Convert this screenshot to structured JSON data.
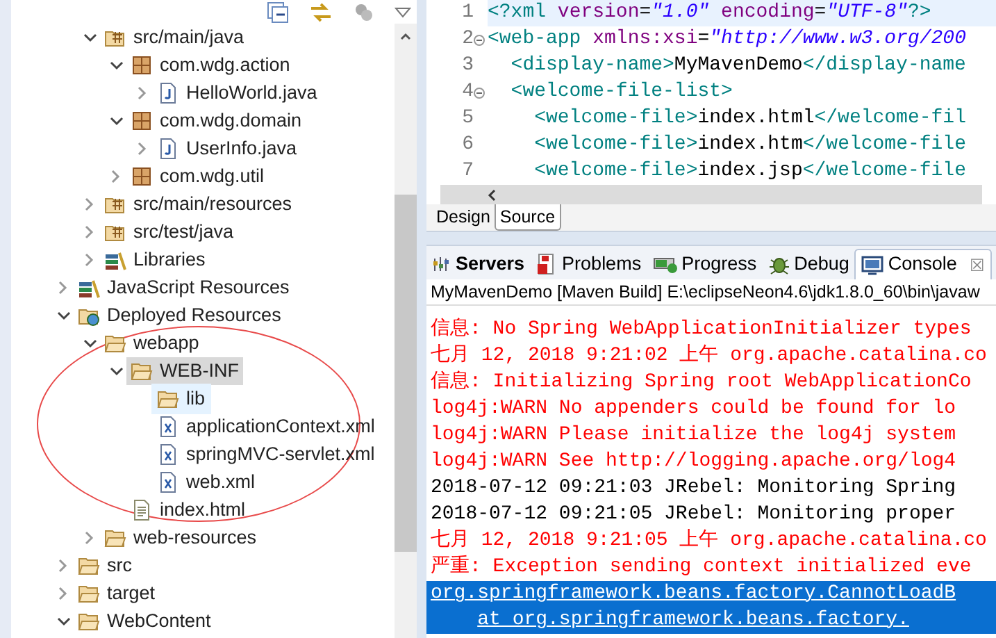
{
  "explorer": {
    "continued_items": [
      {
        "label": "src/main/java",
        "kind": "source-folder",
        "expanded": true,
        "selected": false,
        "hovered": false,
        "children": [
          {
            "label": "com.wdg.action",
            "kind": "package",
            "expanded": true,
            "selected": false,
            "hovered": false,
            "children": [
              {
                "label": "HelloWorld.java",
                "kind": "java-file",
                "expanded": false,
                "selected": false,
                "hovered": false
              }
            ]
          },
          {
            "label": "com.wdg.domain",
            "kind": "package",
            "expanded": true,
            "selected": false,
            "hovered": false,
            "children": [
              {
                "label": "UserInfo.java",
                "kind": "java-file",
                "expanded": false,
                "selected": false,
                "hovered": false
              }
            ]
          },
          {
            "label": "com.wdg.util",
            "kind": "package",
            "expanded": false,
            "selected": false,
            "hovered": false
          }
        ]
      },
      {
        "label": "src/main/resources",
        "kind": "source-folder",
        "expanded": false,
        "selected": false,
        "hovered": false
      },
      {
        "label": "src/test/java",
        "kind": "source-folder",
        "expanded": false,
        "selected": false,
        "hovered": false
      },
      {
        "label": "Libraries",
        "kind": "library",
        "expanded": false,
        "selected": false,
        "hovered": false
      }
    ],
    "items": [
      {
        "label": "JavaScript Resources",
        "kind": "library",
        "expanded": false,
        "selected": false,
        "hovered": false
      },
      {
        "label": "Deployed Resources",
        "kind": "deployed",
        "expanded": true,
        "selected": false,
        "hovered": false,
        "children": [
          {
            "label": "webapp",
            "kind": "folder",
            "expanded": true,
            "selected": false,
            "hovered": false,
            "children": [
              {
                "label": "WEB-INF",
                "kind": "folder",
                "expanded": true,
                "selected": true,
                "hovered": false,
                "children": [
                  {
                    "label": "lib",
                    "kind": "folder",
                    "selected": false,
                    "hovered": true
                  },
                  {
                    "label": "applicationContext.xml",
                    "kind": "xml-file",
                    "selected": false,
                    "hovered": false
                  },
                  {
                    "label": "springMVC-servlet.xml",
                    "kind": "xml-file",
                    "selected": false,
                    "hovered": false
                  },
                  {
                    "label": "web.xml",
                    "kind": "xml-file",
                    "selected": false,
                    "hovered": false
                  }
                ]
              },
              {
                "label": "index.html",
                "kind": "html-file",
                "selected": false,
                "hovered": false
              }
            ]
          },
          {
            "label": "web-resources",
            "kind": "folder",
            "expanded": false,
            "selected": false,
            "hovered": false
          }
        ]
      },
      {
        "label": "src",
        "kind": "folder",
        "expanded": false,
        "selected": false,
        "hovered": false
      },
      {
        "label": "target",
        "kind": "folder",
        "expanded": false,
        "selected": false,
        "hovered": false
      },
      {
        "label": "WebContent",
        "kind": "folder",
        "expanded": true,
        "selected": false,
        "hovered": false
      }
    ]
  },
  "editor": {
    "lines": [
      {
        "number": "1",
        "fold": false,
        "current": true,
        "tokens": [
          {
            "kind": "tag",
            "text": "<?xml"
          },
          {
            "kind": "attr",
            "text": " version"
          },
          {
            "kind": "plain",
            "text": "="
          },
          {
            "kind": "value",
            "text": "\"1.0\""
          },
          {
            "kind": "attr",
            "text": " encoding"
          },
          {
            "kind": "plain",
            "text": "="
          },
          {
            "kind": "value",
            "text": "\"UTF-8\""
          },
          {
            "kind": "tag",
            "text": "?>"
          }
        ]
      },
      {
        "number": "2",
        "fold": true,
        "current": false,
        "tokens": [
          {
            "kind": "tag",
            "text": "<web-app"
          },
          {
            "kind": "attr",
            "text": " xmlns:xsi"
          },
          {
            "kind": "plain",
            "text": "="
          },
          {
            "kind": "value",
            "text": "\"http://www.w3.org/200"
          }
        ]
      },
      {
        "number": "3",
        "fold": false,
        "current": false,
        "tokens": [
          {
            "kind": "tag",
            "text": "  <display-name>"
          },
          {
            "kind": "plain",
            "text": "MyMavenDemo"
          },
          {
            "kind": "tag",
            "text": "</display-name"
          }
        ]
      },
      {
        "number": "4",
        "fold": true,
        "current": false,
        "tokens": [
          {
            "kind": "tag",
            "text": "  <welcome-file-list>"
          }
        ]
      },
      {
        "number": "5",
        "fold": false,
        "current": false,
        "tokens": [
          {
            "kind": "tag",
            "text": "    <welcome-file>"
          },
          {
            "kind": "plain",
            "text": "index.html"
          },
          {
            "kind": "tag",
            "text": "</welcome-fil"
          }
        ]
      },
      {
        "number": "6",
        "fold": false,
        "current": false,
        "tokens": [
          {
            "kind": "tag",
            "text": "    <welcome-file>"
          },
          {
            "kind": "plain",
            "text": "index.htm"
          },
          {
            "kind": "tag",
            "text": "</welcome-file"
          }
        ]
      },
      {
        "number": "7",
        "fold": false,
        "current": false,
        "tokens": [
          {
            "kind": "tag",
            "text": "    <welcome-file>"
          },
          {
            "kind": "plain",
            "text": "index.jsp"
          },
          {
            "kind": "tag",
            "text": "</welcome-file"
          }
        ]
      }
    ],
    "tabs": [
      {
        "label": "Design",
        "selected": false
      },
      {
        "label": "Source",
        "selected": true
      }
    ]
  },
  "console": {
    "tabs": [
      {
        "label": "Servers",
        "kind": "servers",
        "bold": true,
        "selected": false
      },
      {
        "label": "Problems",
        "kind": "problems",
        "bold": false,
        "selected": false
      },
      {
        "label": "Progress",
        "kind": "progress",
        "bold": false,
        "selected": false
      },
      {
        "label": "Debug",
        "kind": "debug",
        "bold": false,
        "selected": false
      },
      {
        "label": "Console",
        "kind": "console",
        "bold": false,
        "selected": true,
        "close": "☒"
      }
    ],
    "title": "MyMavenDemo [Maven Build] E:\\eclipseNeon4.6\\jdk1.8.0_60\\bin\\javaw",
    "lines": [
      {
        "text": "信息: No Spring WebApplicationInitializer types",
        "color": "#ff0000",
        "selected": false
      },
      {
        "text": "七月 12, 2018 9:21:02 上午 org.apache.catalina.co",
        "color": "#ff0000",
        "selected": false
      },
      {
        "text": "信息: Initializing Spring root WebApplicationCo",
        "color": "#ff0000",
        "selected": false
      },
      {
        "text": "log4j:WARN No appenders could be found for lo",
        "color": "#ff0000",
        "selected": false
      },
      {
        "text": "log4j:WARN Please initialize the log4j system",
        "color": "#ff0000",
        "selected": false
      },
      {
        "text": "log4j:WARN See http://logging.apache.org/log4",
        "color": "#ff0000",
        "selected": false
      },
      {
        "text": "2018-07-12 09:21:03 JRebel: Monitoring Spring",
        "color": "#000000",
        "selected": false
      },
      {
        "text": "2018-07-12 09:21:05 JRebel: Monitoring proper",
        "color": "#000000",
        "selected": false
      },
      {
        "text": "七月 12, 2018 9:21:05 上午 org.apache.catalina.co",
        "color": "#ff0000",
        "selected": false
      },
      {
        "text": "严重: Exception sending context initialized eve",
        "color": "#ff0000",
        "selected": false
      },
      {
        "text": "org.springframework.beans.factory.CannotLoadB",
        "color": "#ffffff",
        "selected": true
      },
      {
        "text": "\tat org.springframework.beans.factory.",
        "color": "#ffffff",
        "selected": true
      }
    ]
  }
}
